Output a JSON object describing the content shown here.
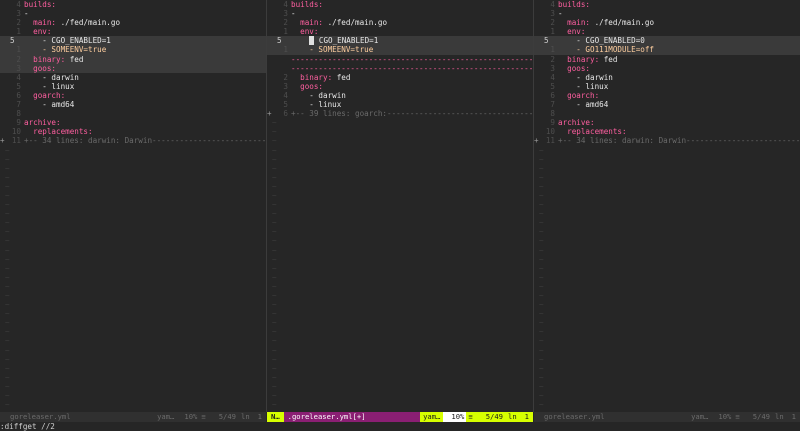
{
  "panes": [
    {
      "lines": [
        {
          "num": "4",
          "text": "builds:",
          "cls": "key"
        },
        {
          "num": "3",
          "text": "-",
          "cls": "str"
        },
        {
          "num": "2",
          "text": "  main: ./fed/main.go",
          "cls": "mixed",
          "key": "  main:",
          "val": " ./fed/main.go"
        },
        {
          "num": "1",
          "text": "  env:",
          "cls": "key"
        },
        {
          "num": "5",
          "cur": true,
          "text": "    - CGO_ENABLED=1",
          "cls": "str",
          "hl": true
        },
        {
          "num": "1",
          "text": "    - SOMEENV=true",
          "cls": "val",
          "hl": true
        },
        {
          "num": "2",
          "text": "  binary: fed",
          "cls": "mixed",
          "key": "  binary:",
          "val": " fed",
          "hl": true
        },
        {
          "num": "3",
          "text": "  goos:",
          "cls": "key",
          "hl": true
        },
        {
          "num": "4",
          "text": "    - darwin",
          "cls": "str"
        },
        {
          "num": "5",
          "text": "    - linux",
          "cls": "str"
        },
        {
          "num": "6",
          "text": "  goarch:",
          "cls": "key"
        },
        {
          "num": "7",
          "text": "    - amd64",
          "cls": "str"
        },
        {
          "num": "8",
          "text": "",
          "cls": "str"
        },
        {
          "num": "9",
          "text": "archive:",
          "cls": "key"
        },
        {
          "num": "10",
          "text": "  replacements:",
          "cls": "key"
        },
        {
          "num": "11",
          "sign": "+",
          "text": "+-- 34 lines: darwin: Darwin------------------------------------",
          "cls": "fold"
        }
      ],
      "tilde_count": 29,
      "status": {
        "file": "goreleaser.yml",
        "type": "yam…",
        "pct": "10%",
        "lines_icon": "≡",
        "pos": "5/49",
        "ln": "ln",
        "col": "1",
        "state": "inactive"
      }
    },
    {
      "lines": [
        {
          "num": "4",
          "text": "builds:",
          "cls": "key"
        },
        {
          "num": "3",
          "text": "-",
          "cls": "str"
        },
        {
          "num": "2",
          "text": "  main: ./fed/main.go",
          "cls": "mixed",
          "key": "  main:",
          "val": " ./fed/main.go"
        },
        {
          "num": "1",
          "text": "  env:",
          "cls": "key"
        },
        {
          "num": "5",
          "cur": true,
          "cursor": true,
          "text": "    - CGO_ENABLED=1",
          "cls": "str",
          "hl": true
        },
        {
          "num": "1",
          "text": "    - SOMEENV=true",
          "cls": "val",
          "hl": true
        },
        {
          "num": "",
          "filler": true,
          "text": "--------------------------------------------------------------------"
        },
        {
          "num": "",
          "filler": true,
          "text": "--------------------------------------------------------------------"
        },
        {
          "num": "2",
          "text": "  binary: fed",
          "cls": "mixed",
          "key": "  binary:",
          "val": " fed"
        },
        {
          "num": "3",
          "text": "  goos:",
          "cls": "key"
        },
        {
          "num": "4",
          "text": "    - darwin",
          "cls": "str"
        },
        {
          "num": "5",
          "text": "    - linux",
          "cls": "str"
        },
        {
          "num": "6",
          "sign": "+",
          "text": "+-- 39 lines: goarch:-------------------------------------------",
          "cls": "fold"
        }
      ],
      "tilde_count": 32,
      "status": {
        "mode": "N…",
        "file": ".goreleaser.yml[+]",
        "type": "yam…",
        "pct": "10%",
        "lines_icon": "≡",
        "pos": "5/49",
        "ln": "ln",
        "col": "1",
        "state": "active"
      }
    },
    {
      "lines": [
        {
          "num": "4",
          "text": "builds:",
          "cls": "key"
        },
        {
          "num": "3",
          "text": "-",
          "cls": "str"
        },
        {
          "num": "2",
          "text": "  main: ./fed/main.go",
          "cls": "mixed",
          "key": "  main:",
          "val": " ./fed/main.go"
        },
        {
          "num": "1",
          "text": "  env:",
          "cls": "key"
        },
        {
          "num": "5",
          "cur": true,
          "text": "    - CGO_ENABLED=0",
          "cls": "str",
          "hl": true
        },
        {
          "num": "1",
          "text": "    - GO111MODULE=off",
          "cls": "val",
          "hl": true
        },
        {
          "num": "2",
          "text": "  binary: fed",
          "cls": "mixed",
          "key": "  binary:",
          "val": " fed"
        },
        {
          "num": "3",
          "text": "  goos:",
          "cls": "key"
        },
        {
          "num": "4",
          "text": "    - darwin",
          "cls": "str"
        },
        {
          "num": "5",
          "text": "    - linux",
          "cls": "str"
        },
        {
          "num": "6",
          "text": "  goarch:",
          "cls": "key"
        },
        {
          "num": "7",
          "text": "    - amd64",
          "cls": "str"
        },
        {
          "num": "8",
          "text": "",
          "cls": "str"
        },
        {
          "num": "9",
          "text": "archive:",
          "cls": "key"
        },
        {
          "num": "10",
          "text": "  replacements:",
          "cls": "key"
        },
        {
          "num": "11",
          "sign": "+",
          "text": "+-- 34 lines: darwin: Darwin------------------------------------",
          "cls": "fold"
        }
      ],
      "tilde_count": 29,
      "status": {
        "file": "goreleaser.yml",
        "type": "yam…",
        "pct": "10%",
        "lines_icon": "≡",
        "pos": "5/49",
        "ln": "ln",
        "col": "1",
        "state": "inactive"
      }
    }
  ],
  "cmdline": ":diffget //2",
  "colors": {
    "mode_bg": "#d7ff00",
    "file_bg": "#8a1f73",
    "right_bg": "#d7ff00",
    "background": "#262626"
  }
}
